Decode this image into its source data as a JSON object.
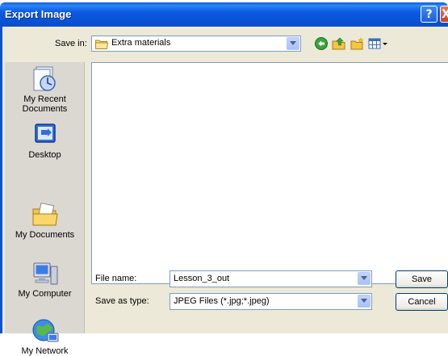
{
  "window": {
    "title": "Export Image"
  },
  "titlebar_buttons": {
    "help": "?",
    "close": "X"
  },
  "save_in": {
    "label": "Save in:",
    "value": "Extra materials"
  },
  "places": [
    {
      "label_line1": "My Recent",
      "label_line2": "Documents",
      "icon": "recent-documents-icon"
    },
    {
      "label_line1": "Desktop",
      "label_line2": "",
      "icon": "desktop-icon"
    },
    {
      "label_line1": "My Documents",
      "label_line2": "",
      "icon": "my-documents-icon"
    },
    {
      "label_line1": "My Computer",
      "label_line2": "",
      "icon": "my-computer-icon"
    },
    {
      "label_line1": "My Network",
      "label_line2": "",
      "icon": "my-network-icon"
    }
  ],
  "file_name": {
    "label": "File name:",
    "value": "Lesson_3_out"
  },
  "save_as_type": {
    "label": "Save as type:",
    "value": "JPEG Files (*.jpg;*.jpeg)"
  },
  "buttons": {
    "save": "Save",
    "cancel": "Cancel"
  },
  "colors": {
    "titlebar": "#0a5ce0",
    "dialog_bg": "#ece9d8",
    "places_bg": "#dbd8d1",
    "field_border": "#7f9db9"
  }
}
